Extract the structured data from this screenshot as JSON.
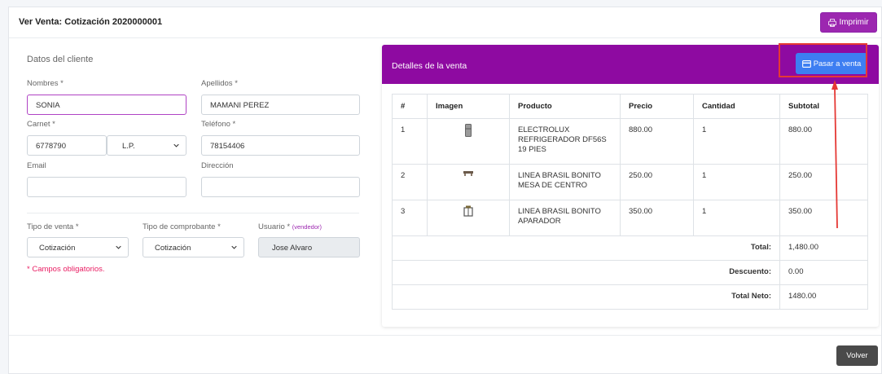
{
  "header": {
    "title": "Ver Venta: Cotización 2020000001",
    "print_label": "Imprimir"
  },
  "client": {
    "section_title": "Datos del cliente",
    "nombres_label": "Nombres *",
    "nombres_value": "SONIA",
    "apellidos_label": "Apellidos *",
    "apellidos_value": "MAMANI PEREZ",
    "carnet_label": "Carnet *",
    "carnet_value": "6778790",
    "carnet_ext": "L.P.",
    "telefono_label": "Teléfono *",
    "telefono_value": "78154406",
    "email_label": "Email",
    "email_value": "",
    "direccion_label": "Dirección",
    "direccion_value": "",
    "tipo_venta_label": "Tipo de venta *",
    "tipo_venta_value": "Cotización",
    "tipo_comprobante_label": "Tipo de comprobante *",
    "tipo_comprobante_value": "Cotización",
    "usuario_label": "Usuario *",
    "usuario_hint": "(vendedor)",
    "usuario_value": "Jose Alvaro",
    "required_note": "* Campos obligatorios."
  },
  "details": {
    "title": "Detalles de la venta",
    "pasar_label": "Pasar a venta",
    "columns": [
      "#",
      "Imagen",
      "Producto",
      "Precio",
      "Cantidad",
      "Subtotal"
    ],
    "rows": [
      {
        "n": "1",
        "icon": "refrigerator-image",
        "producto": "ELECTROLUX REFRIGERADOR DF56S 19 PIES",
        "precio": "880.00",
        "cantidad": "1",
        "subtotal": "880.00"
      },
      {
        "n": "2",
        "icon": "table-image",
        "producto": "LINEA BRASIL BONITO MESA DE CENTRO",
        "precio": "250.00",
        "cantidad": "1",
        "subtotal": "250.00"
      },
      {
        "n": "3",
        "icon": "cabinet-image",
        "producto": "LINEA BRASIL BONITO APARADOR",
        "precio": "350.00",
        "cantidad": "1",
        "subtotal": "350.00"
      }
    ],
    "total_label": "Total:",
    "total_value": "1,480.00",
    "descuento_label": "Descuento:",
    "descuento_value": "0.00",
    "neto_label": "Total Neto:",
    "neto_value": "1480.00"
  },
  "footer": {
    "volver_label": "Volver"
  },
  "colors": {
    "accent": "#9c27b0",
    "header_bg": "#8e0aa1",
    "primary": "#3d7ef2",
    "annotation": "#e53935"
  }
}
